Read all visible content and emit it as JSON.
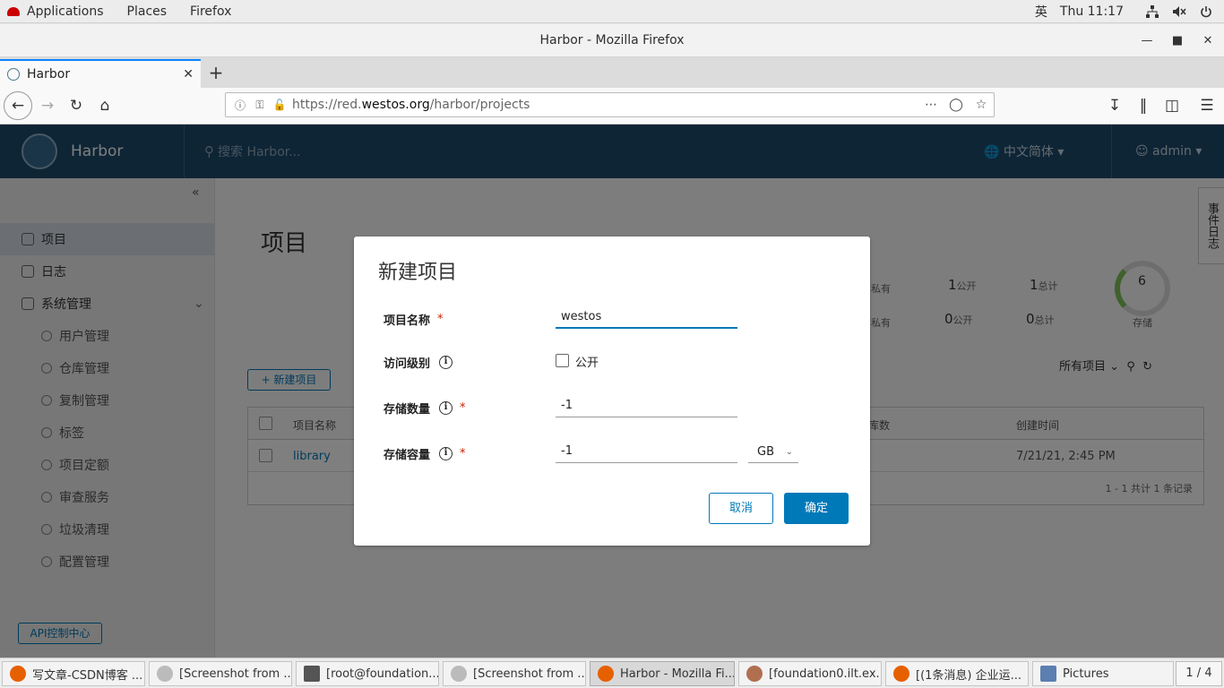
{
  "system": {
    "menus": [
      "Applications",
      "Places",
      "Firefox"
    ],
    "ime": "英",
    "clock": "Thu 11:17"
  },
  "window": {
    "title": "Harbor - Mozilla Firefox"
  },
  "browser": {
    "tab_label": "Harbor",
    "new_tab": "+",
    "url_prefix": "https://red.",
    "url_domain": "westos.org",
    "url_path": "/harbor/projects"
  },
  "harbor": {
    "brand": "Harbor",
    "search_placeholder": "搜索 Harbor...",
    "language": "中文简体",
    "user": "admin",
    "nav": {
      "projects": "项目",
      "logs": "日志",
      "admin": "系统管理",
      "sub": [
        "用户管理",
        "仓库管理",
        "复制管理",
        "标签",
        "项目定额",
        "审查服务",
        "垃圾清理",
        "配置管理"
      ],
      "api": "API控制中心"
    },
    "page_title": "项目",
    "event_log": "事件日志",
    "stats": {
      "private_label": "私有",
      "public_label": "公开",
      "total_label": "总计",
      "row1_public": "1",
      "row1_total": "1",
      "row2_public": "0",
      "row2_total": "0",
      "storage_value": "6",
      "storage_caption": "存储"
    },
    "new_project_btn": "+ 新建项目",
    "filter_label": "所有项目",
    "grid": {
      "col_name": "项目名称",
      "col_repos": "库数",
      "col_created": "创建时间",
      "rows": [
        {
          "name": "library",
          "created": "7/21/21, 2:45 PM"
        }
      ],
      "footer": "1 - 1 共计 1 条记录"
    }
  },
  "modal": {
    "title": "新建项目",
    "name_label": "项目名称",
    "name_value": "westos",
    "access_label": "访问级别",
    "public_label": "公开",
    "count_label": "存储数量",
    "count_value": "-1",
    "capacity_label": "存储容量",
    "capacity_value": "-1",
    "unit": "GB",
    "cancel": "取消",
    "ok": "确定"
  },
  "taskbar": {
    "items": [
      "写文章-CSDN博客 ...",
      "[Screenshot from ...",
      "[root@foundation...",
      "[Screenshot from ...",
      "Harbor - Mozilla Fi...",
      "[foundation0.ilt.ex...",
      "[(1条消息) 企业运...",
      "Pictures"
    ],
    "pager": "1 / 4"
  }
}
